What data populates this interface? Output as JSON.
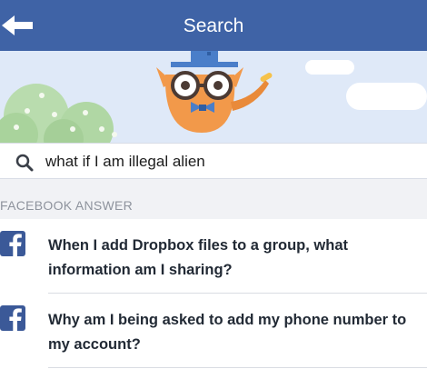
{
  "header": {
    "title": "Search",
    "back_icon": "back-arrow-icon"
  },
  "hero": {
    "illustration": "owl-mascot-illustration"
  },
  "search": {
    "value": "what if I am illegal alien",
    "icon": "search-icon"
  },
  "section": {
    "label": "FACEBOOK ANSWER"
  },
  "answers": [
    {
      "text": "When I add Dropbox files to a group, what information am I sharing?",
      "icon": "facebook-icon"
    },
    {
      "text": "Why am I being asked to add my phone number to my account?",
      "icon": "facebook-icon"
    }
  ],
  "colors": {
    "app_bar": "#3f63a6",
    "hero_bg": "#dfe9f8",
    "facebook_blue": "#3b5998"
  }
}
